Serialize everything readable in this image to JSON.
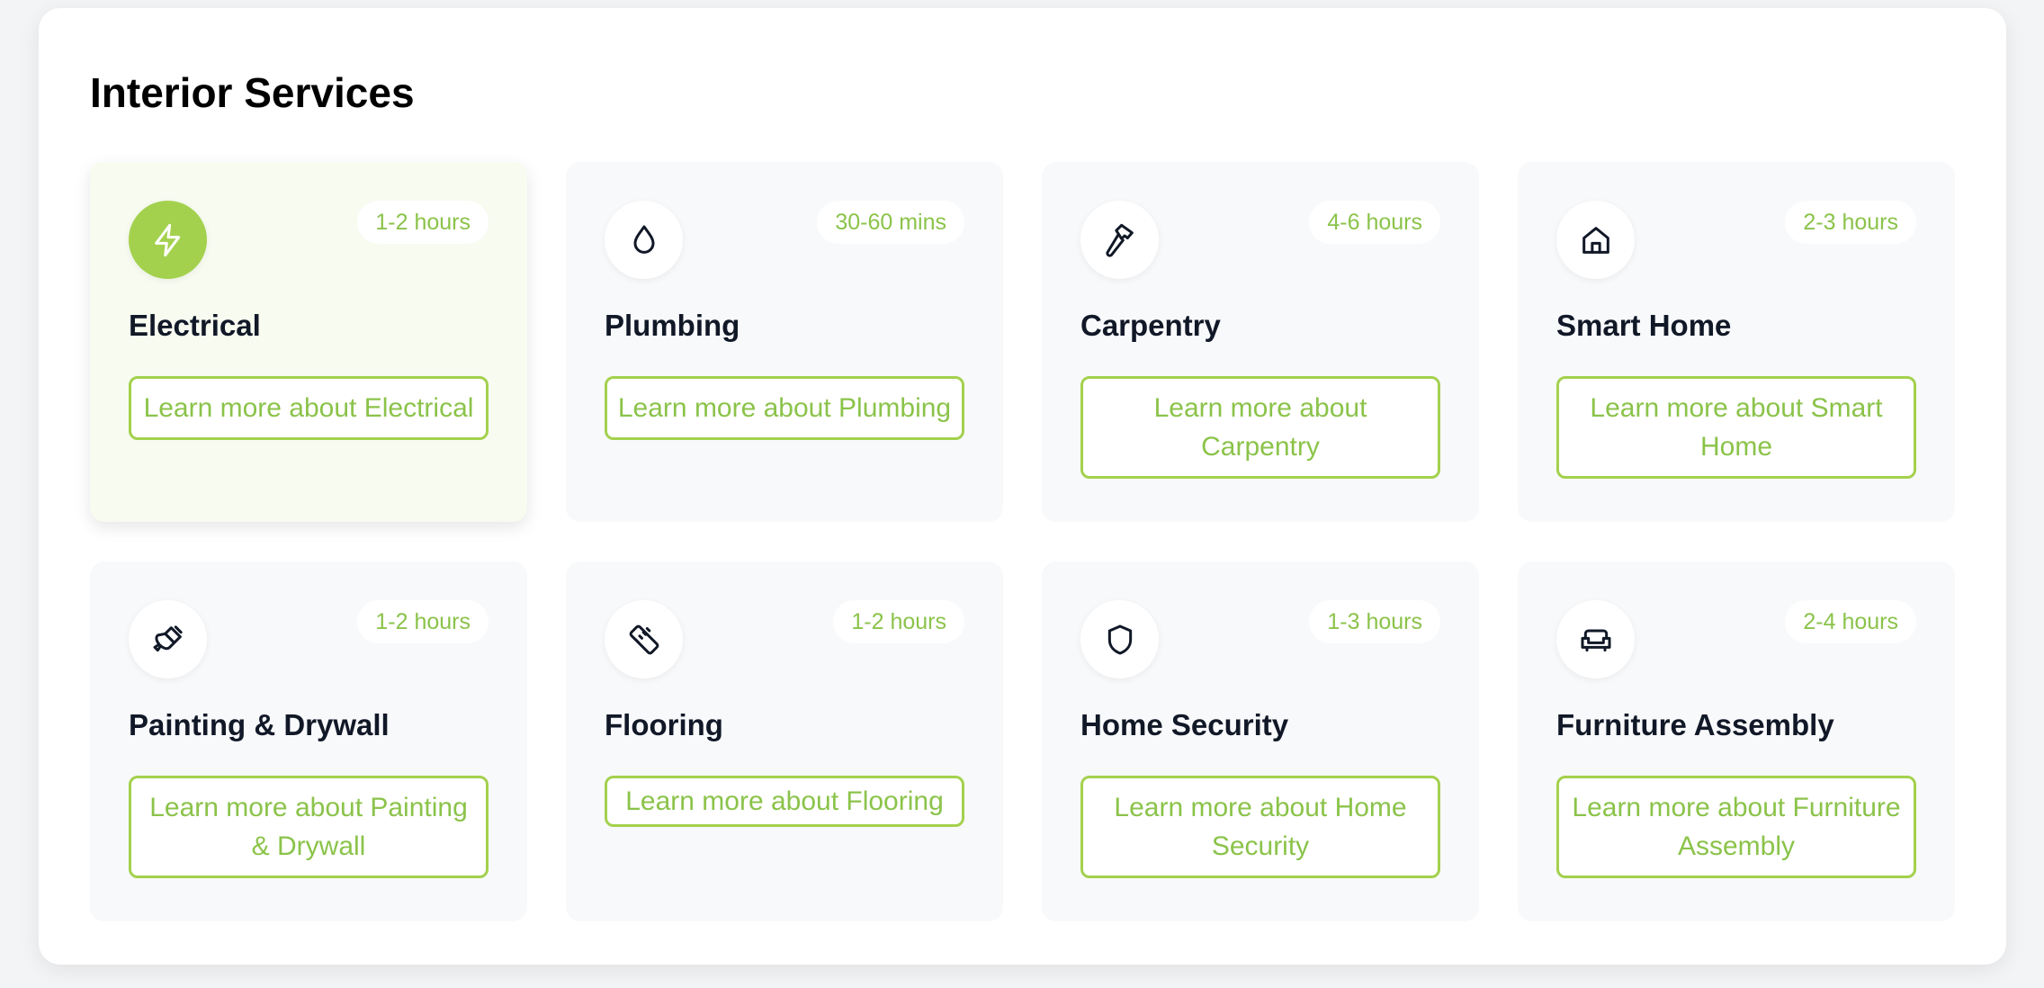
{
  "section": {
    "title": "Interior Services"
  },
  "colors": {
    "accent": "#a3d14d",
    "accent_text": "#8bc34a",
    "card_bg": "#f8f9fb",
    "active_card_bg": "#f7fbf0"
  },
  "services": [
    {
      "name": "Electrical",
      "duration": "1-2 hours",
      "button": "Learn more about Electrical",
      "icon": "lightning-icon",
      "active": true
    },
    {
      "name": "Plumbing",
      "duration": "30-60 mins",
      "button": "Learn more about Plumbing",
      "icon": "droplet-icon"
    },
    {
      "name": "Carpentry",
      "duration": "4-6 hours",
      "button": "Learn more about Carpentry",
      "icon": "hammer-icon"
    },
    {
      "name": "Smart Home",
      "duration": "2-3 hours",
      "button": "Learn more about Smart Home",
      "icon": "home-icon"
    },
    {
      "name": "Painting & Drywall",
      "duration": "1-2 hours",
      "button": "Learn more about Painting & Drywall",
      "icon": "paintbrush-icon"
    },
    {
      "name": "Flooring",
      "duration": "1-2 hours",
      "button": "Learn more about Flooring",
      "icon": "ruler-icon"
    },
    {
      "name": "Home Security",
      "duration": "1-3 hours",
      "button": "Learn more about Home Security",
      "icon": "shield-icon"
    },
    {
      "name": "Furniture Assembly",
      "duration": "2-4 hours",
      "button": "Learn more about Furniture Assembly",
      "icon": "sofa-icon"
    }
  ]
}
